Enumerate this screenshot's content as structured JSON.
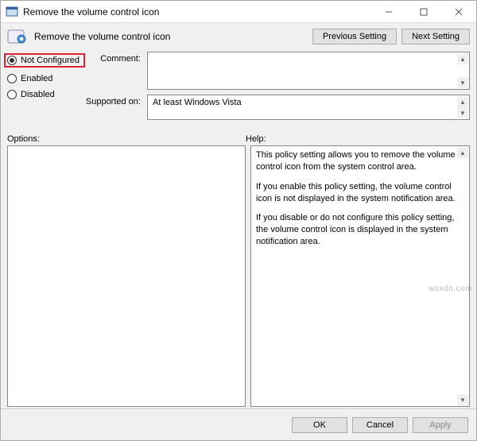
{
  "window": {
    "title": "Remove the volume control icon"
  },
  "header": {
    "policy_title": "Remove the volume control icon",
    "previous": "Previous Setting",
    "next": "Next Setting"
  },
  "states": {
    "not_configured": "Not Configured",
    "enabled": "Enabled",
    "disabled": "Disabled",
    "selected": "not_configured"
  },
  "fields": {
    "comment_label": "Comment:",
    "comment_value": "",
    "supported_label": "Supported on:",
    "supported_value": "At least Windows Vista"
  },
  "panels": {
    "options_label": "Options:",
    "help_label": "Help:",
    "help_p1": "This policy setting allows you to remove the volume control icon from the system control area.",
    "help_p2": "If you enable this policy setting, the volume control icon is not displayed in the system notification area.",
    "help_p3": "If you disable or do not configure this policy setting, the volume control icon is displayed in the system notification area."
  },
  "footer": {
    "ok": "OK",
    "cancel": "Cancel",
    "apply": "Apply"
  },
  "watermark": "wsxdn.com"
}
